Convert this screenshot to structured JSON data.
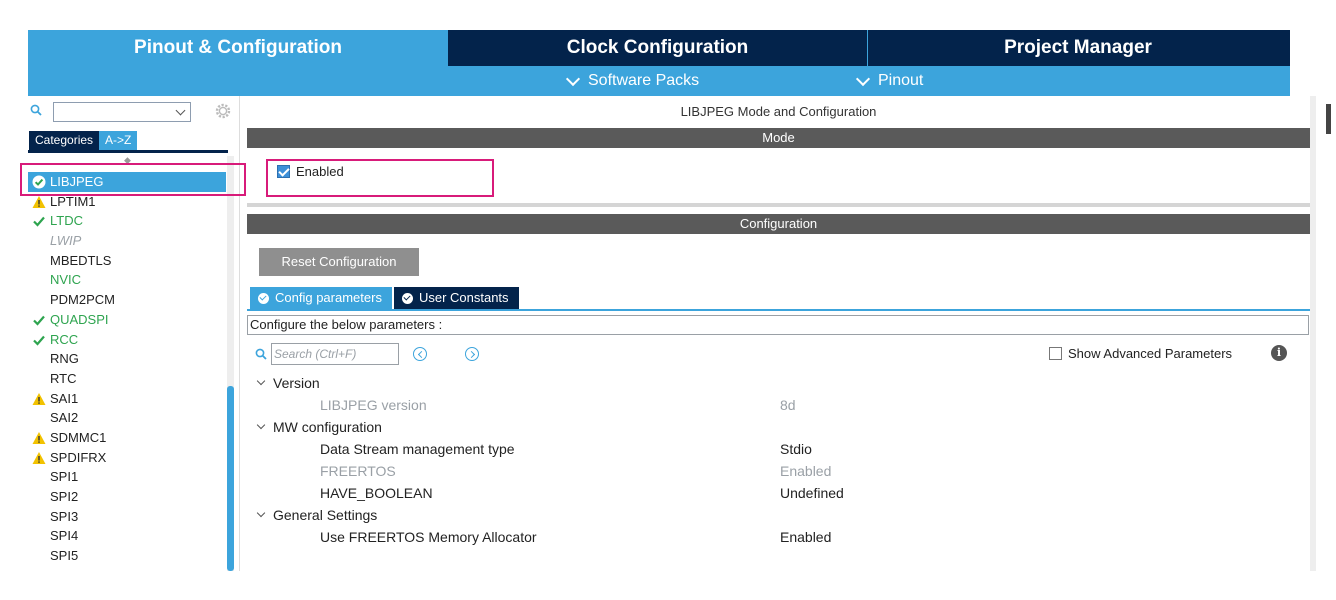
{
  "top_tabs": {
    "pinout": "Pinout & Configuration",
    "clock": "Clock Configuration",
    "project": "Project Manager"
  },
  "subbar": {
    "software_packs": "Software Packs",
    "pinout": "Pinout"
  },
  "sidebar": {
    "tab_categories": "Categories",
    "tab_az": "A->Z",
    "items": [
      {
        "label": "LIBJPEG",
        "status": "ok-selected"
      },
      {
        "label": "LPTIM1",
        "status": "warning"
      },
      {
        "label": "LTDC",
        "status": "check"
      },
      {
        "label": "LWIP",
        "status": "disabled"
      },
      {
        "label": "MBEDTLS",
        "status": "none"
      },
      {
        "label": "NVIC",
        "status": "green"
      },
      {
        "label": "PDM2PCM",
        "status": "none"
      },
      {
        "label": "QUADSPI",
        "status": "check"
      },
      {
        "label": "RCC",
        "status": "check"
      },
      {
        "label": "RNG",
        "status": "none"
      },
      {
        "label": "RTC",
        "status": "none"
      },
      {
        "label": "SAI1",
        "status": "warning"
      },
      {
        "label": "SAI2",
        "status": "none"
      },
      {
        "label": "SDMMC1",
        "status": "warning"
      },
      {
        "label": "SPDIFRX",
        "status": "warning"
      },
      {
        "label": "SPI1",
        "status": "none"
      },
      {
        "label": "SPI2",
        "status": "none"
      },
      {
        "label": "SPI3",
        "status": "none"
      },
      {
        "label": "SPI4",
        "status": "none"
      },
      {
        "label": "SPI5",
        "status": "none"
      }
    ]
  },
  "main": {
    "title": "LIBJPEG Mode and Configuration",
    "mode_header": "Mode",
    "enabled_label": "Enabled",
    "enabled_checked": true,
    "config_header": "Configuration",
    "reset_button": "Reset Configuration",
    "tab_config_params": "Config parameters",
    "tab_user_constants": "User Constants",
    "configure_text": "Configure the below parameters :",
    "search_placeholder": "Search (Ctrl+F)",
    "show_advanced": "Show Advanced Parameters",
    "info_glyph": "i",
    "tree": {
      "version_group": "Version",
      "libjpeg_version_label": "LIBJPEG version",
      "libjpeg_version_value": "8d",
      "mw_group": "MW configuration",
      "data_stream_label": "Data Stream management type",
      "data_stream_value": "Stdio",
      "freertos_label": "FREERTOS",
      "freertos_value": "Enabled",
      "have_boolean_label": "HAVE_BOOLEAN",
      "have_boolean_value": "Undefined",
      "general_group": "General Settings",
      "freertos_alloc_label": "Use FREERTOS Memory Allocator",
      "freertos_alloc_value": "Enabled"
    }
  },
  "colors": {
    "accent_blue": "#3ca4dc",
    "dark_navy": "#03234b",
    "section_grey": "#5a5a5a",
    "highlight_magenta": "#d81b7a",
    "status_green": "#2ea44f",
    "warning_yellow": "#f2c200"
  }
}
